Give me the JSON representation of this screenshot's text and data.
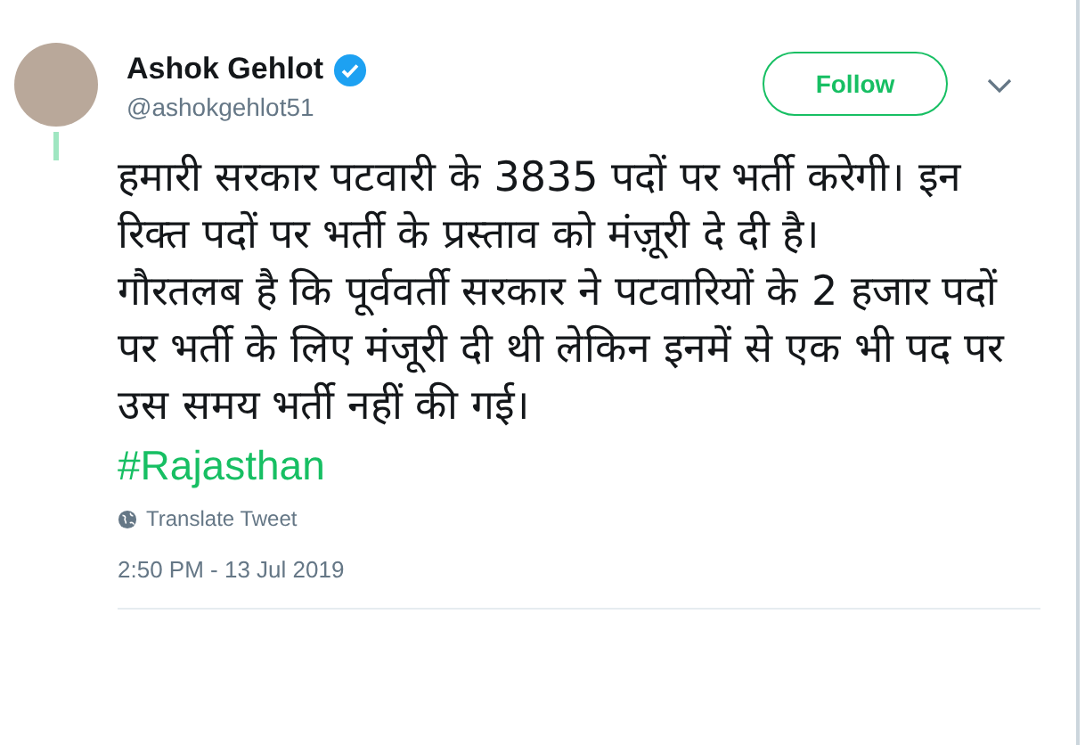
{
  "author": {
    "name": "Ashok Gehlot",
    "verified": true,
    "handle": "@ashokgehlot51"
  },
  "follow_button": {
    "label": "Follow"
  },
  "tweet": {
    "paragraphs": [
      "हमारी सरकार पटवारी के 3835 पदों पर भर्ती करेगी। इन रिक्त पदों पर भर्ती के प्रस्ताव को मंज़ूरी दे दी है।",
      "गौरतलब है कि पूर्ववर्ती सरकार ने पटवारियों के 2 हजार पदों पर भर्ती के लिए मंजूरी दी थी लेकिन इनमें से एक भी पद पर उस समय भर्ती नहीं की गई।"
    ],
    "hashtag": "#Rajasthan"
  },
  "translate_link": "Translate Tweet",
  "timestamp": "2:50 PM - 13 Jul 2019"
}
